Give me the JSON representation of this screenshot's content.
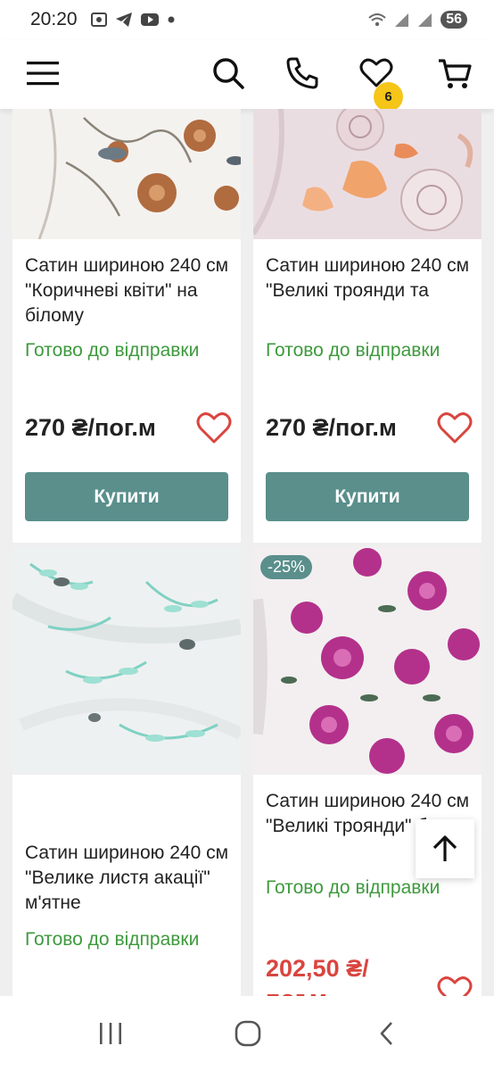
{
  "status": {
    "time": "20:20",
    "battery": "56",
    "left_icons": [
      "screenshot-icon",
      "telegram-icon",
      "youtube-icon",
      "dot-icon"
    ],
    "right_icons": [
      "wifi-icon",
      "signal-icon",
      "signal-icon"
    ]
  },
  "header": {
    "icons": [
      "menu-icon",
      "search-icon",
      "phone-icon",
      "heart-icon",
      "cart-icon"
    ],
    "wishlist_count": "6"
  },
  "products": [
    {
      "title": "Сатин шириною 240 см \"Коричневі квіти\" на білому",
      "availability": "Готово до відправки",
      "price": "270 ₴/пог.м",
      "buy_label": "Купити",
      "image": "brown-flowers-fabric"
    },
    {
      "title": "Сатин шириною 240 см \"Великі троянди та",
      "availability": "Готово до відправки",
      "price": "270 ₴/пог.м",
      "buy_label": "Купити",
      "image": "big-roses-fabric"
    },
    {
      "title": "Сатин шириною 240 см \"Велике листя акації\" м'ятне",
      "availability": "Готово до відправки",
      "image": "mint-acacia-leaves-fabric"
    },
    {
      "title": "Сатин шириною 240 см \"Великі троянди\" бузко",
      "availability": "Готово до відправки",
      "price_line1": "202,50 ₴/",
      "price_line2": "пог.м",
      "discount": "-25%",
      "image": "lilac-roses-fabric"
    }
  ],
  "colors": {
    "accent": "#5a8f8c",
    "available": "#3e9a3e",
    "sale": "#d9453f",
    "heart": "#d9453f",
    "badge": "#f5c518"
  },
  "navbar": {
    "icons": [
      "recent-apps-icon",
      "home-icon",
      "back-icon"
    ]
  }
}
